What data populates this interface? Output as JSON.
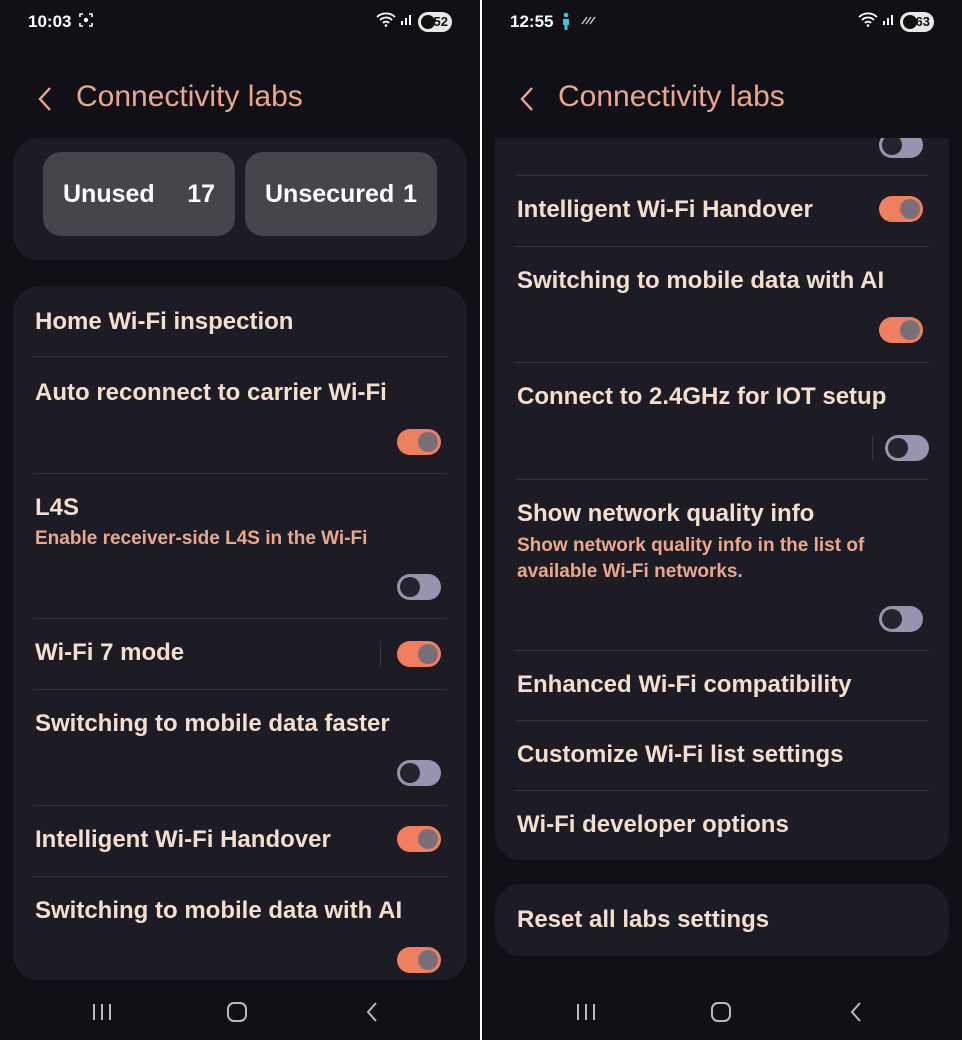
{
  "left": {
    "status": {
      "time": "10:03",
      "battery": "52"
    },
    "header": {
      "title": "Connectivity labs"
    },
    "stats": [
      {
        "label": "Unused",
        "value": "17"
      },
      {
        "label": "Unsecured",
        "value": "1"
      }
    ],
    "items": [
      {
        "title": "Home Wi-Fi inspection"
      },
      {
        "title": "Auto reconnect to carrier Wi-Fi",
        "toggle": "on"
      },
      {
        "title": "L4S",
        "subtitle": "Enable receiver-side L4S in the Wi-Fi",
        "toggle": "off"
      },
      {
        "title": "Wi-Fi 7 mode",
        "toggle": "on"
      },
      {
        "title": "Switching to mobile data faster",
        "toggle": "off"
      },
      {
        "title": "Intelligent Wi-Fi Handover",
        "toggle": "on"
      },
      {
        "title": "Switching to mobile data with AI",
        "toggle": "on"
      }
    ]
  },
  "right": {
    "status": {
      "time": "12:55",
      "battery": "63"
    },
    "header": {
      "title": "Connectivity labs"
    },
    "items": [
      {
        "title": "Intelligent Wi-Fi Handover",
        "toggle": "on"
      },
      {
        "title": "Switching to mobile data with AI",
        "toggle": "on"
      },
      {
        "title": "Connect to 2.4GHz for IOT setup",
        "toggle": "off"
      },
      {
        "title": "Show network quality info",
        "subtitle_line1": "Show network quality info in the list of",
        "subtitle_line2": "available Wi-Fi networks.",
        "toggle": "off"
      },
      {
        "title": "Enhanced Wi-Fi compatibility"
      },
      {
        "title": "Customize Wi-Fi list settings"
      },
      {
        "title": "Wi-Fi developer options"
      }
    ],
    "reset": {
      "label": "Reset all labs settings"
    }
  },
  "colors": {
    "background": "#121017",
    "panel": "#1d1b24",
    "accent": "#e9a88e",
    "text": "#f3dfcf",
    "toggle_on": "#ef7f5f",
    "toggle_off": "#9a93b0"
  },
  "icons": [
    "back-chevron-icon",
    "wifi-icon",
    "signal-icon",
    "battery-icon",
    "screenshot-icon",
    "person-icon",
    "recents-icon",
    "home-icon",
    "back-icon"
  ]
}
